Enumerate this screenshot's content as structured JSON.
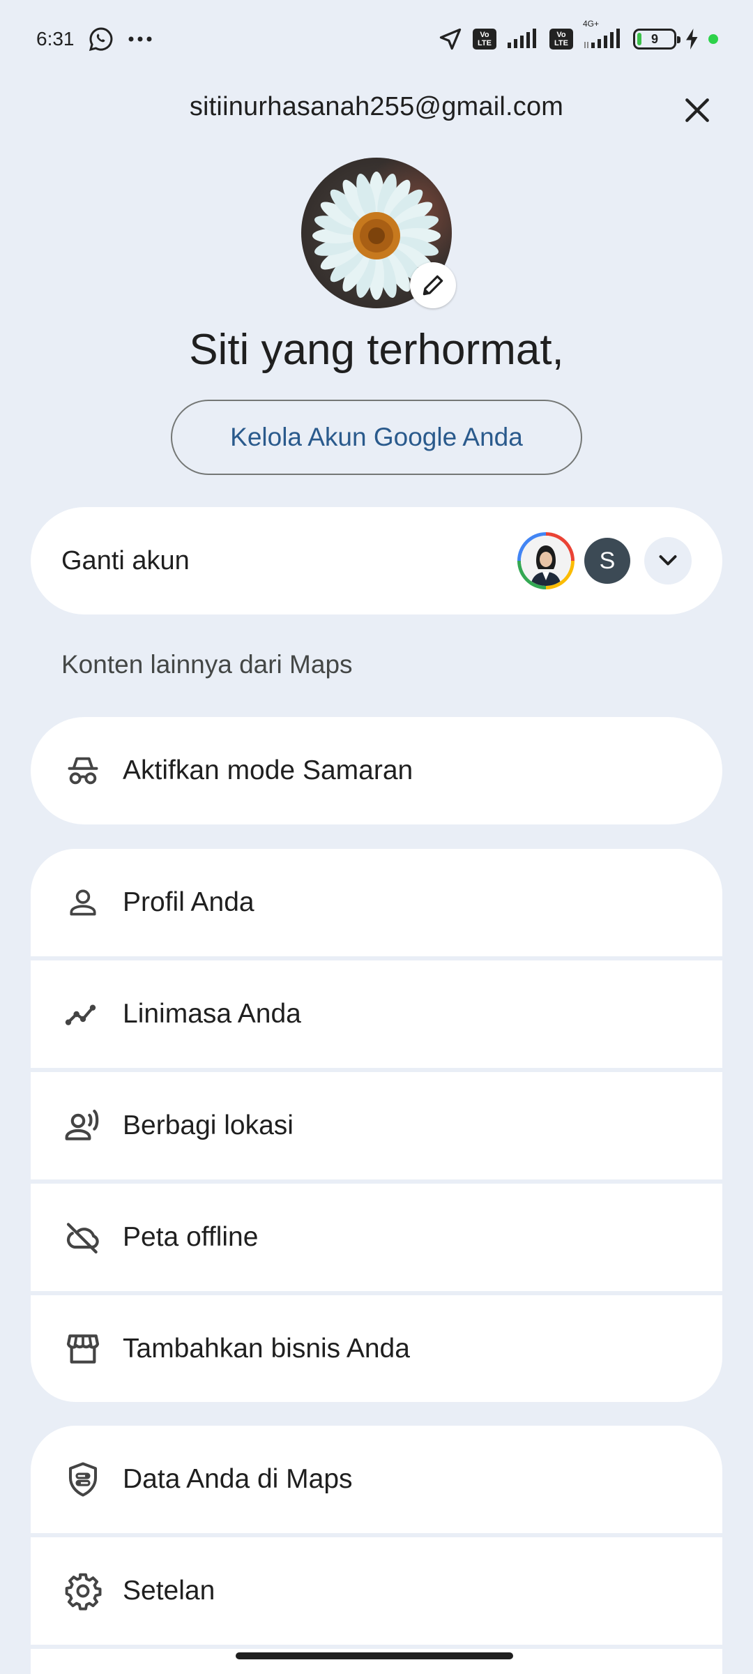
{
  "status_bar": {
    "time": "6:31",
    "battery_level": "9",
    "network": "4G+",
    "volte_top": "Vo",
    "volte_bottom": "LTE"
  },
  "account": {
    "email": "sitiinurhasanah255@gmail.com",
    "greeting": "Siti yang terhormat,",
    "manage_button": "Kelola Akun Google Anda"
  },
  "switch_account": {
    "label": "Ganti akun",
    "other_account_initial": "S"
  },
  "section": {
    "heading": "Konten lainnya dari Maps"
  },
  "menu": {
    "incognito": "Aktifkan mode Samaran",
    "group1": [
      {
        "label": "Profil Anda",
        "icon": "person-icon"
      },
      {
        "label": "Linimasa Anda",
        "icon": "timeline-icon"
      },
      {
        "label": "Berbagi lokasi",
        "icon": "location-sharing-icon"
      },
      {
        "label": "Peta offline",
        "icon": "cloud-off-icon"
      },
      {
        "label": "Tambahkan bisnis Anda",
        "icon": "storefront-icon"
      }
    ],
    "group2": [
      {
        "label": "Data Anda di Maps",
        "icon": "shield-data-icon"
      },
      {
        "label": "Setelan",
        "icon": "gear-icon"
      }
    ]
  },
  "colors": {
    "background": "#e9eef6",
    "card": "#ffffff",
    "link_text": "#2a5a8c"
  }
}
